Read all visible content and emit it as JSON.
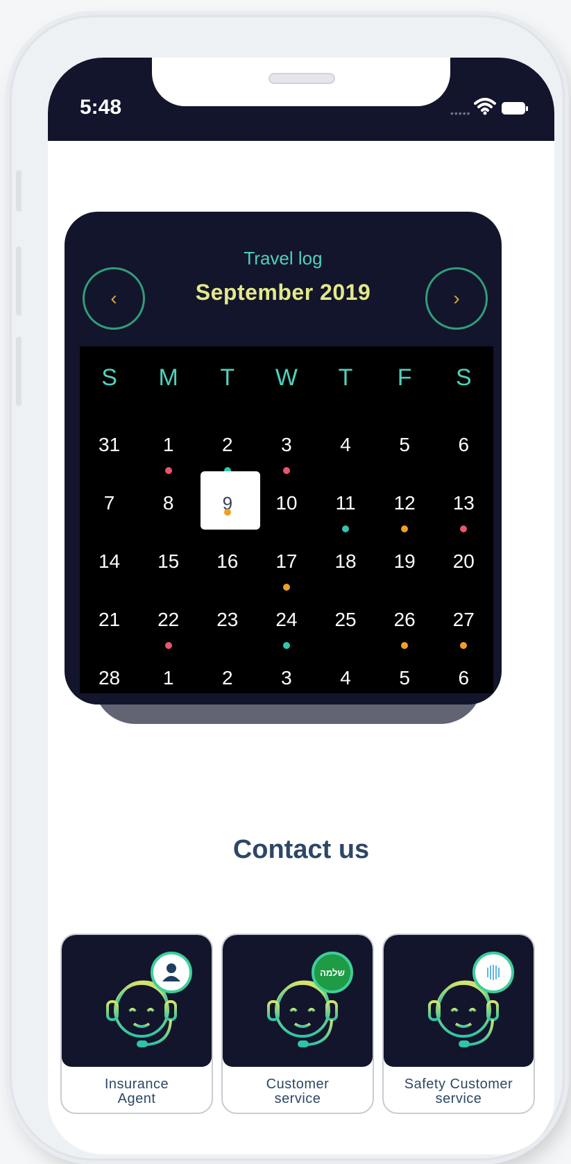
{
  "status_bar": {
    "time": "5:48"
  },
  "calendar": {
    "subtitle": "Travel log",
    "title": "September 2019",
    "prev_icon": "chevron-left-icon",
    "next_icon": "chevron-right-icon",
    "weekdays": [
      "S",
      "M",
      "T",
      "W",
      "T",
      "F",
      "S"
    ],
    "selected_day": "9",
    "colors": {
      "pink": "#e8566c",
      "teal": "#2ec7b0",
      "orange": "#f0a020"
    },
    "weeks": [
      [
        {
          "d": "31"
        },
        {
          "d": "1",
          "dot": "pink"
        },
        {
          "d": "2",
          "dot": "teal"
        },
        {
          "d": "3",
          "dot": "pink"
        },
        {
          "d": "4"
        },
        {
          "d": "5"
        },
        {
          "d": "6"
        }
      ],
      [
        {
          "d": "7"
        },
        {
          "d": "8"
        },
        {
          "d": "9",
          "dot": "orange",
          "selected": true
        },
        {
          "d": "10"
        },
        {
          "d": "11",
          "dot": "teal"
        },
        {
          "d": "12",
          "dot": "orange"
        },
        {
          "d": "13",
          "dot": "pink"
        }
      ],
      [
        {
          "d": "14"
        },
        {
          "d": "15"
        },
        {
          "d": "16"
        },
        {
          "d": "17",
          "dot": "orange"
        },
        {
          "d": "18"
        },
        {
          "d": "19"
        },
        {
          "d": "20"
        }
      ],
      [
        {
          "d": "21"
        },
        {
          "d": "22",
          "dot": "pink"
        },
        {
          "d": "23"
        },
        {
          "d": "24",
          "dot": "teal"
        },
        {
          "d": "25"
        },
        {
          "d": "26",
          "dot": "orange"
        },
        {
          "d": "27",
          "dot": "orange"
        }
      ],
      [
        {
          "d": "28"
        },
        {
          "d": "1"
        },
        {
          "d": "2"
        },
        {
          "d": "3"
        },
        {
          "d": "4"
        },
        {
          "d": "5"
        },
        {
          "d": "6"
        }
      ]
    ]
  },
  "contact": {
    "title": "Contact us",
    "cards": [
      {
        "label_line1": "Insurance",
        "label_line2": "Agent",
        "icon": "person-badge-icon"
      },
      {
        "label_line1": "Customer",
        "label_line2": "service",
        "icon": "shalom-badge-icon",
        "badge_text": "שלמה"
      },
      {
        "label_line1": "Safety Customer",
        "label_line2": "service",
        "icon": "fingerprint-badge-icon"
      }
    ]
  }
}
